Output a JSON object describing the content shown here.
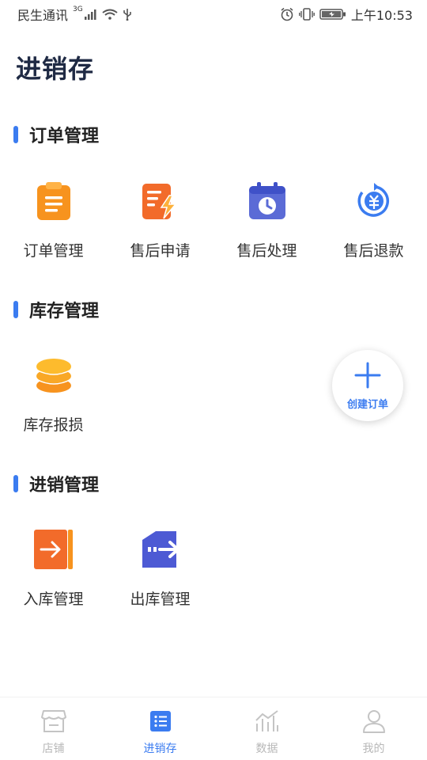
{
  "status_bar": {
    "carrier": "民生通讯",
    "network": "3G",
    "time": "上午10:53"
  },
  "page_title": "进销存",
  "sections": [
    {
      "title": "订单管理",
      "items": [
        {
          "label": "订单管理",
          "icon": "clipboard-icon"
        },
        {
          "label": "售后申请",
          "icon": "document-lightning-icon"
        },
        {
          "label": "售后处理",
          "icon": "calendar-clock-icon"
        },
        {
          "label": "售后退款",
          "icon": "yuan-refund-icon"
        }
      ]
    },
    {
      "title": "库存管理",
      "items": [
        {
          "label": "库存报损",
          "icon": "coin-stack-icon"
        }
      ]
    },
    {
      "title": "进销管理",
      "items": [
        {
          "label": "入库管理",
          "icon": "box-arrow-in-icon"
        },
        {
          "label": "出库管理",
          "icon": "truck-arrow-out-icon"
        }
      ]
    }
  ],
  "fab": {
    "label": "创建订单"
  },
  "tabs": [
    {
      "label": "店铺",
      "icon": "store-icon",
      "active": false
    },
    {
      "label": "进销存",
      "icon": "list-icon",
      "active": true
    },
    {
      "label": "数据",
      "icon": "chart-icon",
      "active": false
    },
    {
      "label": "我的",
      "icon": "user-icon",
      "active": false
    }
  ],
  "colors": {
    "accent": "#3b7cf0",
    "orange": "#f7931e",
    "purple": "#5b6bd6",
    "inactive": "#b8b8b8"
  }
}
